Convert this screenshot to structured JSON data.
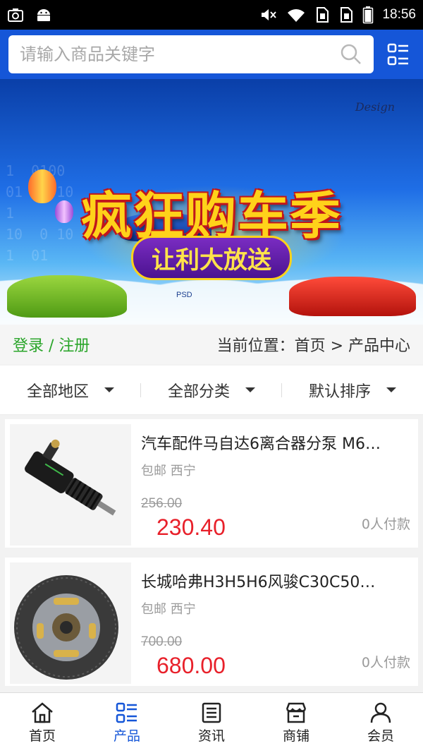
{
  "status_bar": {
    "time": "18:56",
    "left_icons": [
      "screenshot-icon",
      "android-icon"
    ],
    "right_icons": [
      "mute-icon",
      "wifi-icon",
      "sim1-icon",
      "sim2-icon",
      "battery-icon"
    ]
  },
  "search": {
    "placeholder": "请输入商品关键字",
    "value": ""
  },
  "banner": {
    "title": "疯狂购车季",
    "subtitle": "让利大放送",
    "corner_text": "Design",
    "fine_print": "PSD"
  },
  "crumb": {
    "login": "登录 / 注册",
    "location": "当前位置：首页 > 产品中心"
  },
  "filters": [
    {
      "label": "全部地区"
    },
    {
      "label": "全部分类"
    },
    {
      "label": "默认排序"
    }
  ],
  "products": [
    {
      "title": "汽车配件马自达6离合器分泵 M6…",
      "tags": "包邮 西宁",
      "old_price": "256.00",
      "price": "230.40",
      "paid": "0人付款"
    },
    {
      "title": "长城哈弗H3H5H6风骏C30C50…",
      "tags": "包邮 西宁",
      "old_price": "700.00",
      "price": "680.00",
      "paid": "0人付款"
    }
  ],
  "tabs": [
    {
      "label": "首页",
      "icon": "home-icon",
      "active": false
    },
    {
      "label": "产品",
      "icon": "grid-list-icon",
      "active": true
    },
    {
      "label": "资讯",
      "icon": "news-icon",
      "active": false
    },
    {
      "label": "商铺",
      "icon": "store-icon",
      "active": false
    },
    {
      "label": "会员",
      "icon": "user-icon",
      "active": false
    }
  ],
  "colors": {
    "brand": "#1556d8",
    "price": "#e8202a",
    "login": "#2aa52a"
  }
}
